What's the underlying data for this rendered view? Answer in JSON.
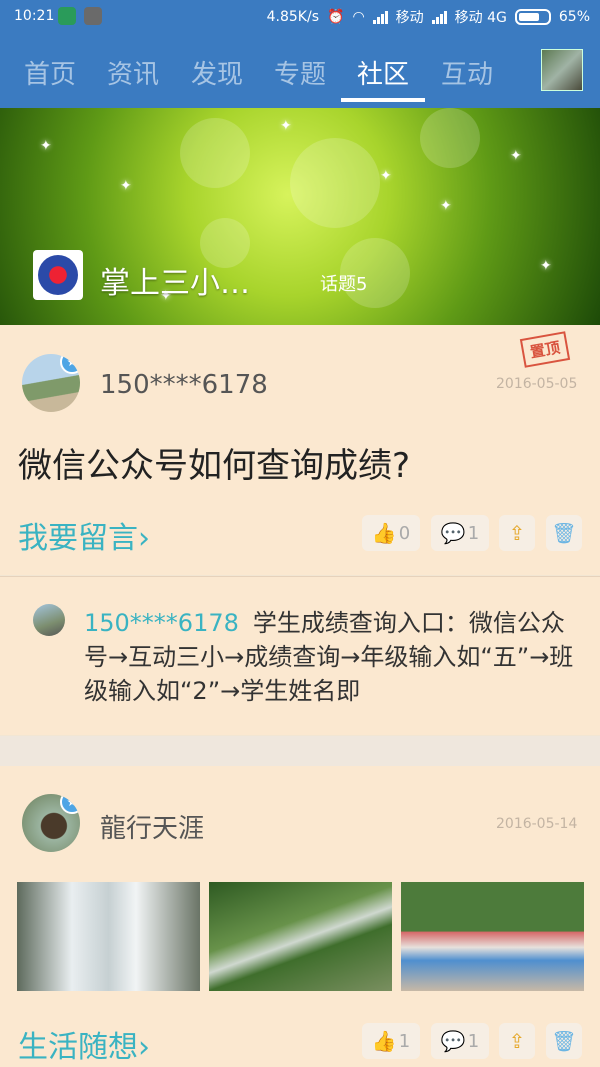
{
  "status_bar": {
    "time": "10:21",
    "speed": "4.85K/s",
    "carrier1": "移动",
    "carrier2": "移动 4G",
    "battery": "65%"
  },
  "nav": {
    "tabs": [
      {
        "label": "首页"
      },
      {
        "label": "资讯"
      },
      {
        "label": "发现"
      },
      {
        "label": "专题"
      },
      {
        "label": "社区"
      },
      {
        "label": "互动"
      }
    ],
    "active_tab": "社区"
  },
  "banner": {
    "school_name": "掌上三小…",
    "topic_count": "话题5"
  },
  "posts": [
    {
      "user": "150****6178",
      "date": "2016-05-05",
      "pinned_label": "置顶",
      "title": "微信公众号如何查询成绩?",
      "category": "我要留言",
      "likes": "0",
      "comments": "1",
      "reply": {
        "user": "150****6178",
        "text": "学生成绩查询入口：微信公众号→互动三小→成绩查询→年级输入如“五”→班级输入如“2”→学生姓名即"
      }
    },
    {
      "user": "龍行天涯",
      "date": "2016-05-14",
      "category": "生活随想",
      "likes": "1",
      "comments": "1"
    }
  ],
  "colors": {
    "nav_bg": "#3b7bc1",
    "card_bg": "#fbe8d0",
    "accent_teal": "#3ab3c2"
  }
}
